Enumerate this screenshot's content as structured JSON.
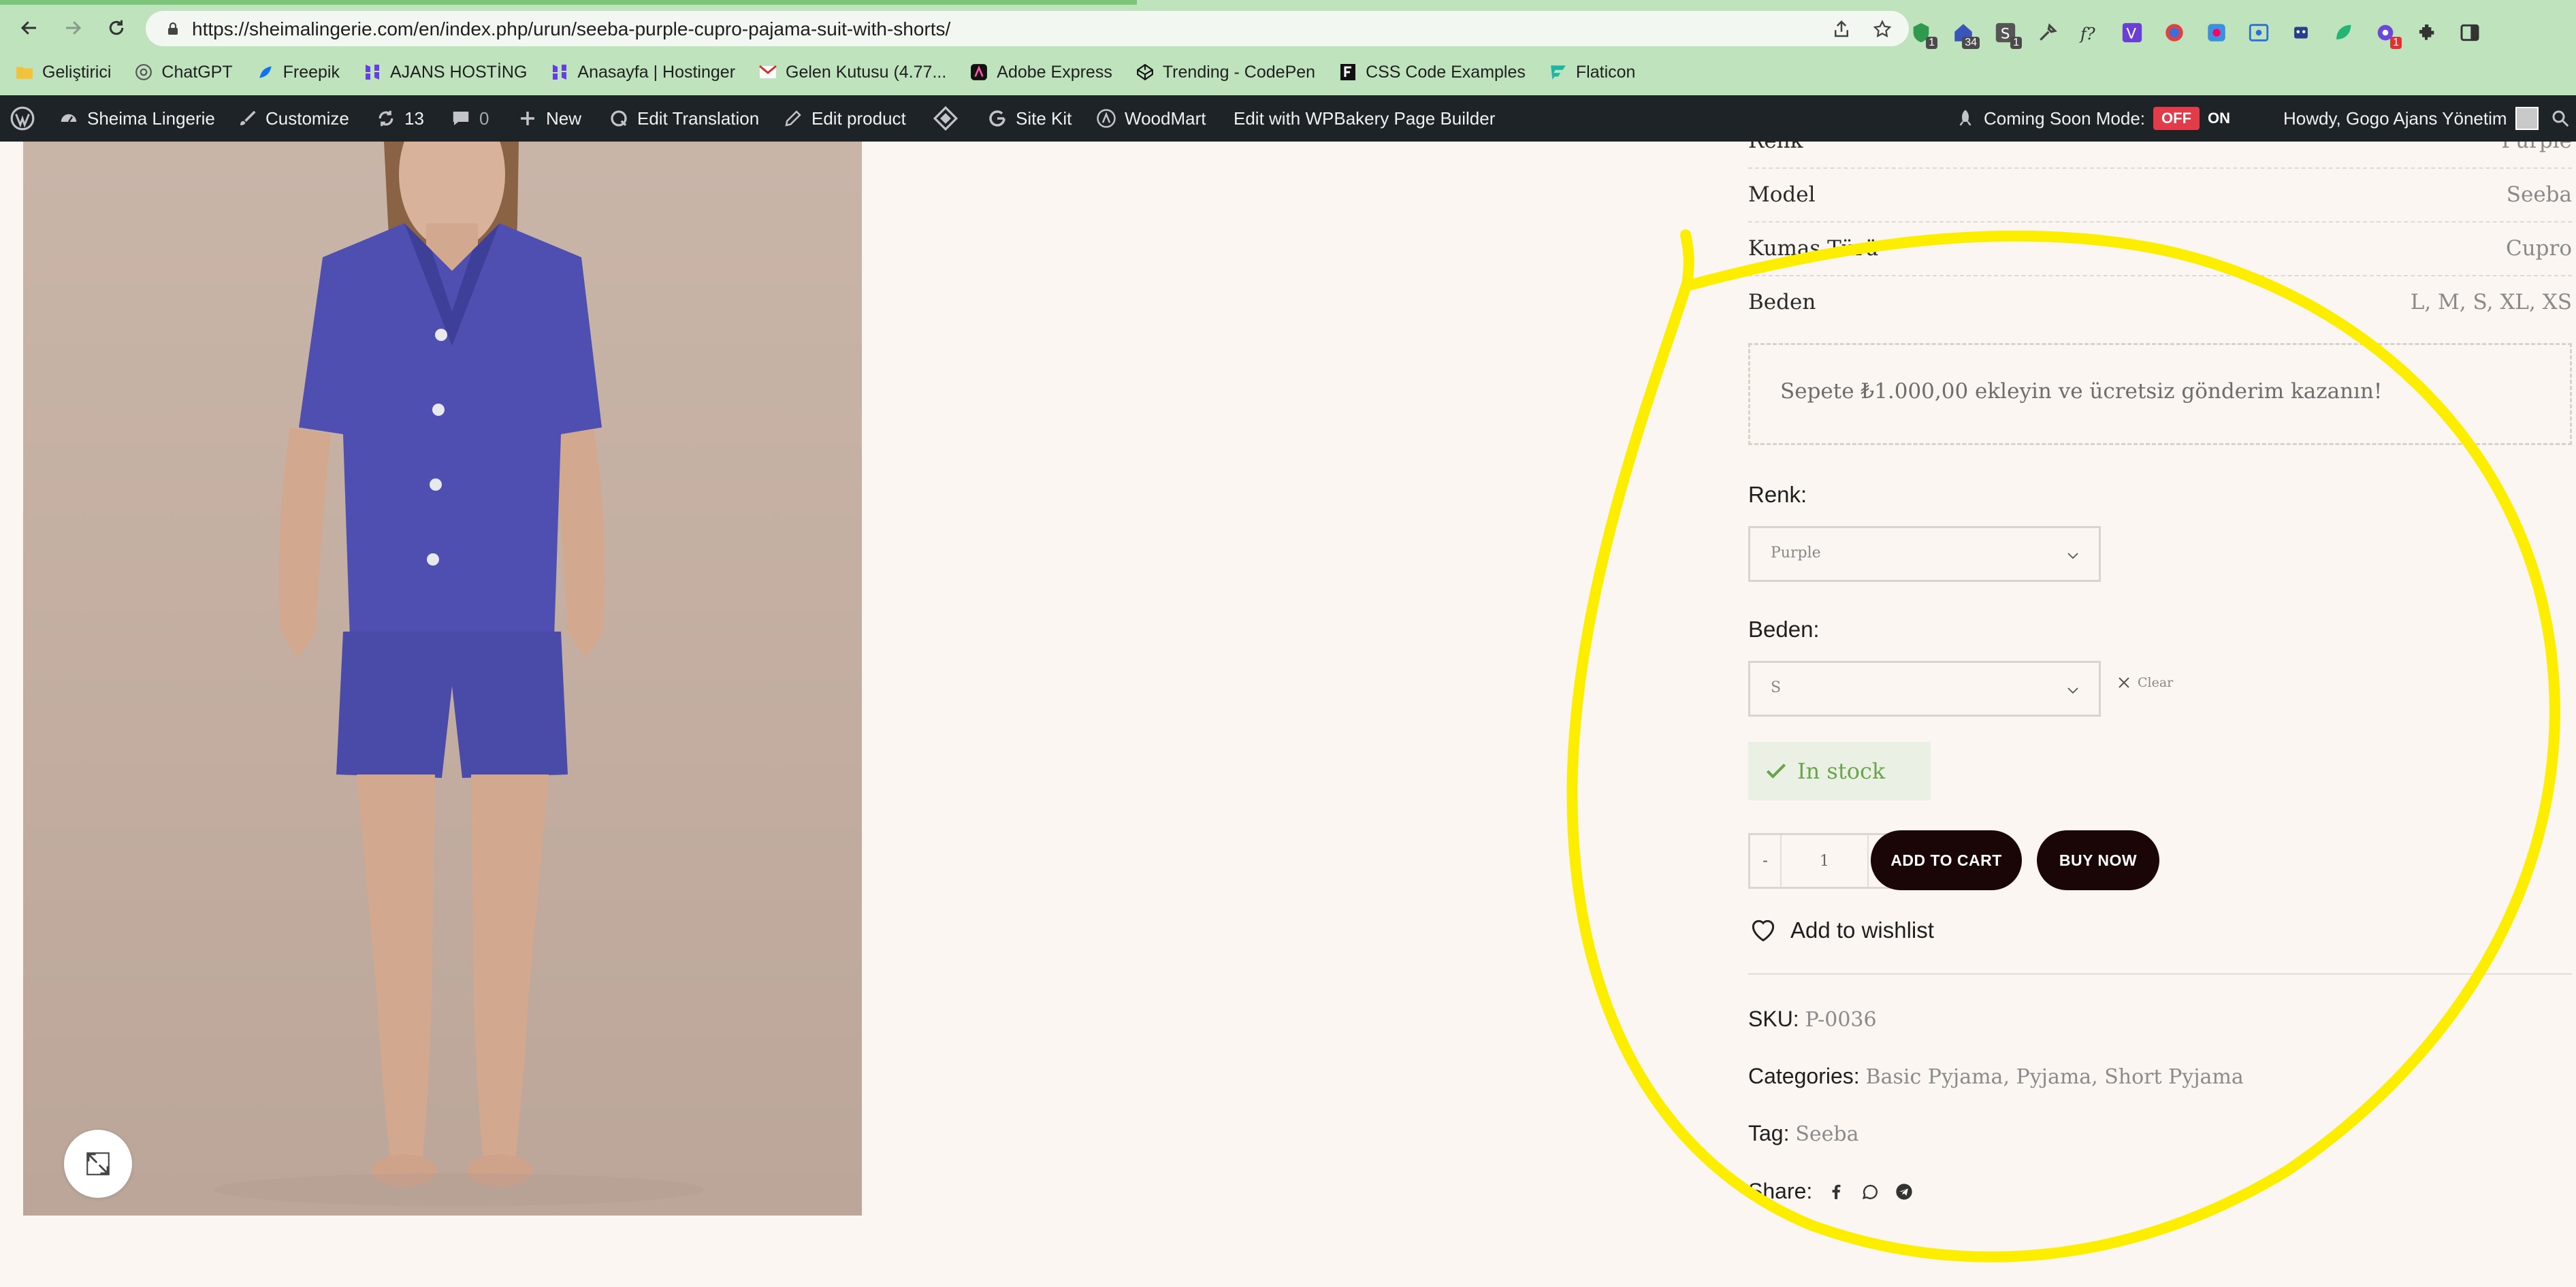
{
  "browser": {
    "url": "https://sheimalingerie.com/en/index.php/urun/seeba-purple-cupro-pajama-suit-with-shorts/",
    "extension_badges": [
      "1",
      "34",
      "1",
      "1"
    ],
    "bookmarks": [
      "Geliştirici",
      "ChatGPT",
      "Freepik",
      "AJANS HOSTİNG",
      "Anasayfa | Hostinger",
      "Gelen Kutusu (4.77...",
      "Adobe Express",
      "Trending - CodePen",
      "CSS Code Examples",
      "Flaticon"
    ]
  },
  "adminbar": {
    "site_name": "Sheima Lingerie",
    "customize": "Customize",
    "updates_count": "13",
    "comments_count": "0",
    "new": "New",
    "edit_translation": "Edit Translation",
    "edit_product": "Edit product",
    "site_kit": "Site Kit",
    "woodmart": "WoodMart",
    "wpbakery": "Edit with WPBakery Page Builder",
    "coming_soon": "Coming Soon Mode:",
    "off": "OFF",
    "on": "ON",
    "howdy": "Howdy, Gogo Ajans Yönetim"
  },
  "product": {
    "attributes": [
      {
        "name": "Renk",
        "value": "Purple"
      },
      {
        "name": "Model",
        "value": "Seeba"
      },
      {
        "name": "Kumaş Türü",
        "value": "Cupro"
      },
      {
        "name": "Beden",
        "value": "L, M, S, XL, XS"
      }
    ],
    "free_shipping": "Sepete ₺1.000,00 ekleyin ve ücretsiz gönderim kazanın!",
    "color_label": "Renk:",
    "color_value": "Purple",
    "size_label": "Beden:",
    "size_value": "S",
    "clear": "Clear",
    "stock": "In stock",
    "qty_minus": "-",
    "qty_value": "1",
    "qty_plus": "+",
    "add_to_cart": "ADD TO CART",
    "buy_now": "BUY NOW",
    "wishlist": "Add to wishlist",
    "sku_label": "SKU:",
    "sku": "P-0036",
    "categories_label": "Categories:",
    "categories": "Basic Pyjama, Pyjama, Short Pyjama",
    "tag_label": "Tag:",
    "tag": "Seeba",
    "share_label": "Share:"
  },
  "colors": {
    "chrome_bg": "#bfe3bd",
    "adminbar_bg": "#1d2327",
    "page_bg": "#fbf6f1",
    "dark_button": "#1a0606",
    "stock_green": "#6aa54c",
    "off_red": "#e23b4a",
    "annotation_yellow": "#fdee00",
    "pajama_purple": "#4e4fb1"
  },
  "icons": [
    "back-arrow-icon",
    "forward-arrow-icon",
    "reload-icon",
    "lock-icon",
    "share-icon",
    "star-icon",
    "extensions-icon",
    "sidebar-icon",
    "wordpress-logo-icon",
    "dashboard-icon",
    "brush-icon",
    "updates-icon",
    "comment-icon",
    "plus-icon",
    "translate-icon",
    "pencil-icon",
    "diamond-icon",
    "google-icon",
    "woodmart-icon",
    "rocket-icon",
    "chevron-down-icon",
    "close-icon",
    "check-icon",
    "heart-icon",
    "facebook-icon",
    "whatsapp-icon",
    "telegram-icon",
    "expand-icon"
  ]
}
